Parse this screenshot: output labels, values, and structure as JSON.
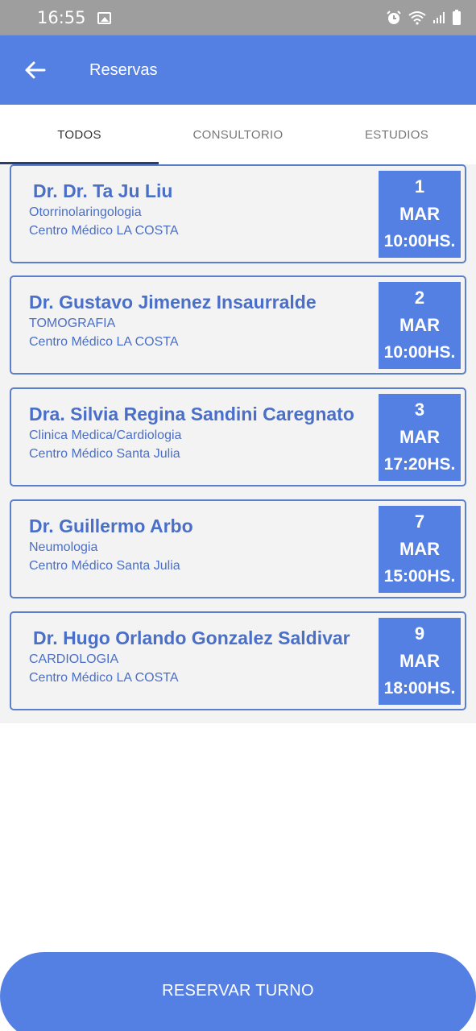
{
  "status_bar": {
    "time": "16:55",
    "icons": [
      "image-icon",
      "alarm-icon",
      "wifi-icon",
      "signal-icon",
      "battery-icon"
    ]
  },
  "app_bar": {
    "back_icon": "arrow-left-icon",
    "title": "Reservas",
    "color": "#5580e3"
  },
  "tabs": [
    {
      "label": "TODOS",
      "active": true
    },
    {
      "label": "CONSULTORIO",
      "active": false
    },
    {
      "label": "ESTUDIOS",
      "active": false
    }
  ],
  "appointments": [
    {
      "doctor": "Dr. Dr. Ta Ju Liu",
      "specialty": "Otorrinolaringologia",
      "center": "Centro Médico LA COSTA",
      "day": "1",
      "month": "MAR",
      "time": "10:00HS."
    },
    {
      "doctor": "Dr. Gustavo Jimenez Insaurralde",
      "specialty": "TOMOGRAFIA",
      "center": "Centro Médico LA COSTA",
      "day": "2",
      "month": "MAR",
      "time": "10:00HS."
    },
    {
      "doctor": "Dra. Silvia Regina Sandini Caregnato",
      "specialty": "Clinica Medica/Cardiologia",
      "center": "Centro Médico Santa Julia",
      "day": "3",
      "month": "MAR",
      "time": "17:20HS."
    },
    {
      "doctor": "Dr. Guillermo Arbo",
      "specialty": "Neumologia",
      "center": "Centro Médico Santa Julia",
      "day": "7",
      "month": "MAR",
      "time": "15:00HS."
    },
    {
      "doctor": "Dr. Hugo Orlando Gonzalez Saldivar",
      "specialty": "CARDIOLOGIA",
      "center": "Centro Médico LA COSTA",
      "day": "9",
      "month": "MAR",
      "time": "18:00HS."
    }
  ],
  "footer": {
    "reserve_label": "RESERVAR TURNO"
  }
}
